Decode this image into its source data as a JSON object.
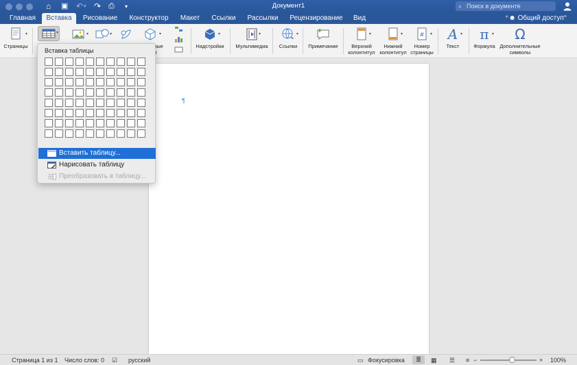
{
  "window": {
    "title": "Документ1",
    "search_placeholder": "Поиск в документе"
  },
  "tabs": [
    {
      "label": "Главная",
      "active": false
    },
    {
      "label": "Вставка",
      "active": true
    },
    {
      "label": "Рисование",
      "active": false
    },
    {
      "label": "Конструктор",
      "active": false
    },
    {
      "label": "Макет",
      "active": false
    },
    {
      "label": "Ссылки",
      "active": false
    },
    {
      "label": "Рассылки",
      "active": false
    },
    {
      "label": "Рецензирование",
      "active": false
    },
    {
      "label": "Вид",
      "active": false
    }
  ],
  "share_label": "Общий доступ",
  "ribbon": {
    "pages": "Страницы",
    "shapes_partial_1": "рные",
    "shapes_partial_2": "ли",
    "addins": "Надстройки",
    "media": "Мультимедиа",
    "links": "Ссылки",
    "comment": "Примечание",
    "header_1": "Верхний",
    "header_2": "колонтитул",
    "footer_1": "Нижний",
    "footer_2": "колонтитул",
    "pagenum_1": "Номер",
    "pagenum_2": "страницы",
    "text": "Текст",
    "formula": "Формула",
    "symbols_1": "Дополнительные",
    "symbols_2": "символы"
  },
  "table_menu": {
    "title": "Вставка таблицы",
    "grid_cols": 10,
    "grid_rows": 8,
    "insert_table": "Вставить таблицу...",
    "draw_table": "Нарисовать таблицу",
    "convert_table": "Преобразовать в таблицу..."
  },
  "document": {
    "pilcrow": "¶"
  },
  "statusbar": {
    "page": "Страница 1 из 1",
    "words": "Число слов: 0",
    "language": "русский",
    "focus": "Фокусировка",
    "zoom_minus": "−",
    "zoom_plus": "+",
    "zoom": "100%"
  },
  "colors": {
    "brand": "#2a579a",
    "highlight": "#1f6fd6"
  }
}
